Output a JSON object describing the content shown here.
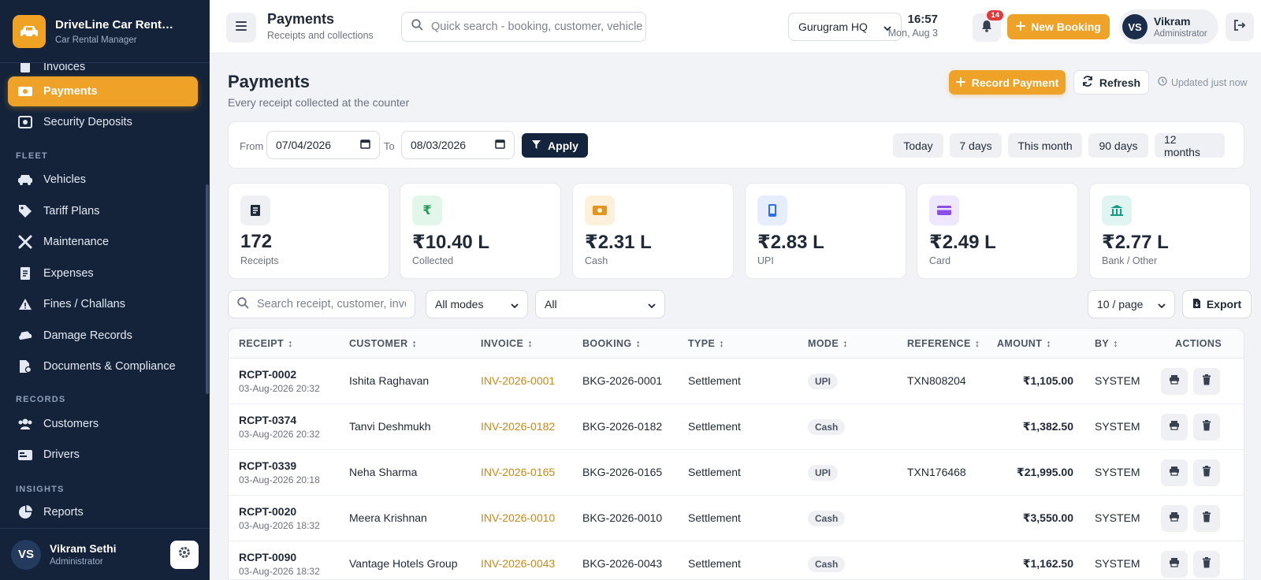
{
  "app": {
    "name": "DriveLine Car Rent…",
    "subtitle": "Car Rental Manager"
  },
  "sidebar": {
    "partial_item": "Invoices",
    "items": [
      {
        "label": "Payments",
        "icon": "cash-icon",
        "active": true
      },
      {
        "label": "Security Deposits",
        "icon": "deposit-icon"
      },
      {
        "label": "Vehicles",
        "icon": "car-icon"
      },
      {
        "label": "Tariff Plans",
        "icon": "tag-icon"
      },
      {
        "label": "Maintenance",
        "icon": "tools-icon"
      },
      {
        "label": "Expenses",
        "icon": "receipt-icon"
      },
      {
        "label": "Fines / Challans",
        "icon": "warning-icon"
      },
      {
        "label": "Damage Records",
        "icon": "car-crash-icon"
      },
      {
        "label": "Documents & Compliance",
        "icon": "document-icon"
      },
      {
        "label": "Customers",
        "icon": "users-icon"
      },
      {
        "label": "Drivers",
        "icon": "id-card-icon"
      },
      {
        "label": "Reports",
        "icon": "pie-chart-icon"
      }
    ],
    "sections": {
      "fleet": "FLEET",
      "records": "RECORDS",
      "insights": "INSIGHTS"
    },
    "user": {
      "initials": "VS",
      "name": "Vikram Sethi",
      "role": "Administrator"
    }
  },
  "topbar": {
    "title": "Payments",
    "subtitle": "Receipts and collections",
    "search_placeholder": "Quick search - booking, customer, vehicle",
    "branch": "Gurugram HQ",
    "time": "16:57",
    "date": "Mon, Aug 3",
    "notifications": "14",
    "new_booking": "New Booking",
    "user": {
      "initials": "VS",
      "name": "Vikram",
      "role": "Administrator"
    }
  },
  "page": {
    "title": "Payments",
    "subtitle": "Every receipt collected at the counter",
    "record_payment": "Record Payment",
    "refresh": "Refresh",
    "updated": "Updated just now"
  },
  "filters": {
    "from_label": "From",
    "from_value": "07/04/2026",
    "to_label": "To",
    "to_value": "08/03/2026",
    "apply": "Apply",
    "presets": [
      "Today",
      "7 days",
      "This month",
      "90 days",
      "12 months"
    ]
  },
  "stats": [
    {
      "value": "172",
      "label": "Receipts",
      "icon": "receipt-icon",
      "bg": "#eef0f4",
      "fg": "#1f2937"
    },
    {
      "value": "₹10.40 L",
      "label": "Collected",
      "icon": "rupee-icon",
      "bg": "#e3f6ea",
      "fg": "#1f9d55"
    },
    {
      "value": "₹2.31 L",
      "label": "Cash",
      "icon": "cash-icon",
      "bg": "#fdf1dc",
      "fg": "#e2961d"
    },
    {
      "value": "₹2.83 L",
      "label": "UPI",
      "icon": "mobile-icon",
      "bg": "#e6eefe",
      "fg": "#2f6ee8"
    },
    {
      "value": "₹2.49 L",
      "label": "Card",
      "icon": "credit-card-icon",
      "bg": "#efe7fd",
      "fg": "#8b4ee8"
    },
    {
      "value": "₹2.77 L",
      "label": "Bank / Other",
      "icon": "bank-icon",
      "bg": "#e0f5f1",
      "fg": "#159a86"
    }
  ],
  "table_controls": {
    "search_placeholder": "Search receipt, customer, invoice",
    "mode_filter": "All modes",
    "type_filter": "All",
    "page_size": "10 / page",
    "export": "Export"
  },
  "table": {
    "columns": [
      "RECEIPT",
      "CUSTOMER",
      "INVOICE",
      "BOOKING",
      "TYPE",
      "MODE",
      "REFERENCE",
      "AMOUNT",
      "BY",
      "ACTIONS"
    ],
    "rows": [
      {
        "receipt": "RCPT-0002",
        "datetime": "03-Aug-2026 20:32",
        "customer": "Ishita Raghavan",
        "invoice": "INV-2026-0001",
        "booking": "BKG-2026-0001",
        "type": "Settlement",
        "mode": "UPI",
        "reference": "TXN808204",
        "amount": "₹1,105.00",
        "by": "SYSTEM"
      },
      {
        "receipt": "RCPT-0374",
        "datetime": "03-Aug-2026 20:32",
        "customer": "Tanvi Deshmukh",
        "invoice": "INV-2026-0182",
        "booking": "BKG-2026-0182",
        "type": "Settlement",
        "mode": "Cash",
        "reference": "",
        "amount": "₹1,382.50",
        "by": "SYSTEM"
      },
      {
        "receipt": "RCPT-0339",
        "datetime": "03-Aug-2026 20:18",
        "customer": "Neha Sharma",
        "invoice": "INV-2026-0165",
        "booking": "BKG-2026-0165",
        "type": "Settlement",
        "mode": "UPI",
        "reference": "TXN176468",
        "amount": "₹21,995.00",
        "by": "SYSTEM"
      },
      {
        "receipt": "RCPT-0020",
        "datetime": "03-Aug-2026 18:32",
        "customer": "Meera Krishnan",
        "invoice": "INV-2026-0010",
        "booking": "BKG-2026-0010",
        "type": "Settlement",
        "mode": "Cash",
        "reference": "",
        "amount": "₹3,550.00",
        "by": "SYSTEM"
      },
      {
        "receipt": "RCPT-0090",
        "datetime": "03-Aug-2026 18:32",
        "customer": "Vantage Hotels Group",
        "invoice": "INV-2026-0043",
        "booking": "BKG-2026-0043",
        "type": "Settlement",
        "mode": "Cash",
        "reference": "",
        "amount": "₹1,162.50",
        "by": "SYSTEM"
      }
    ]
  },
  "colors": {
    "accent": "#eea228",
    "sidebar": "#14233a",
    "invoice_link": "#c9891b"
  }
}
